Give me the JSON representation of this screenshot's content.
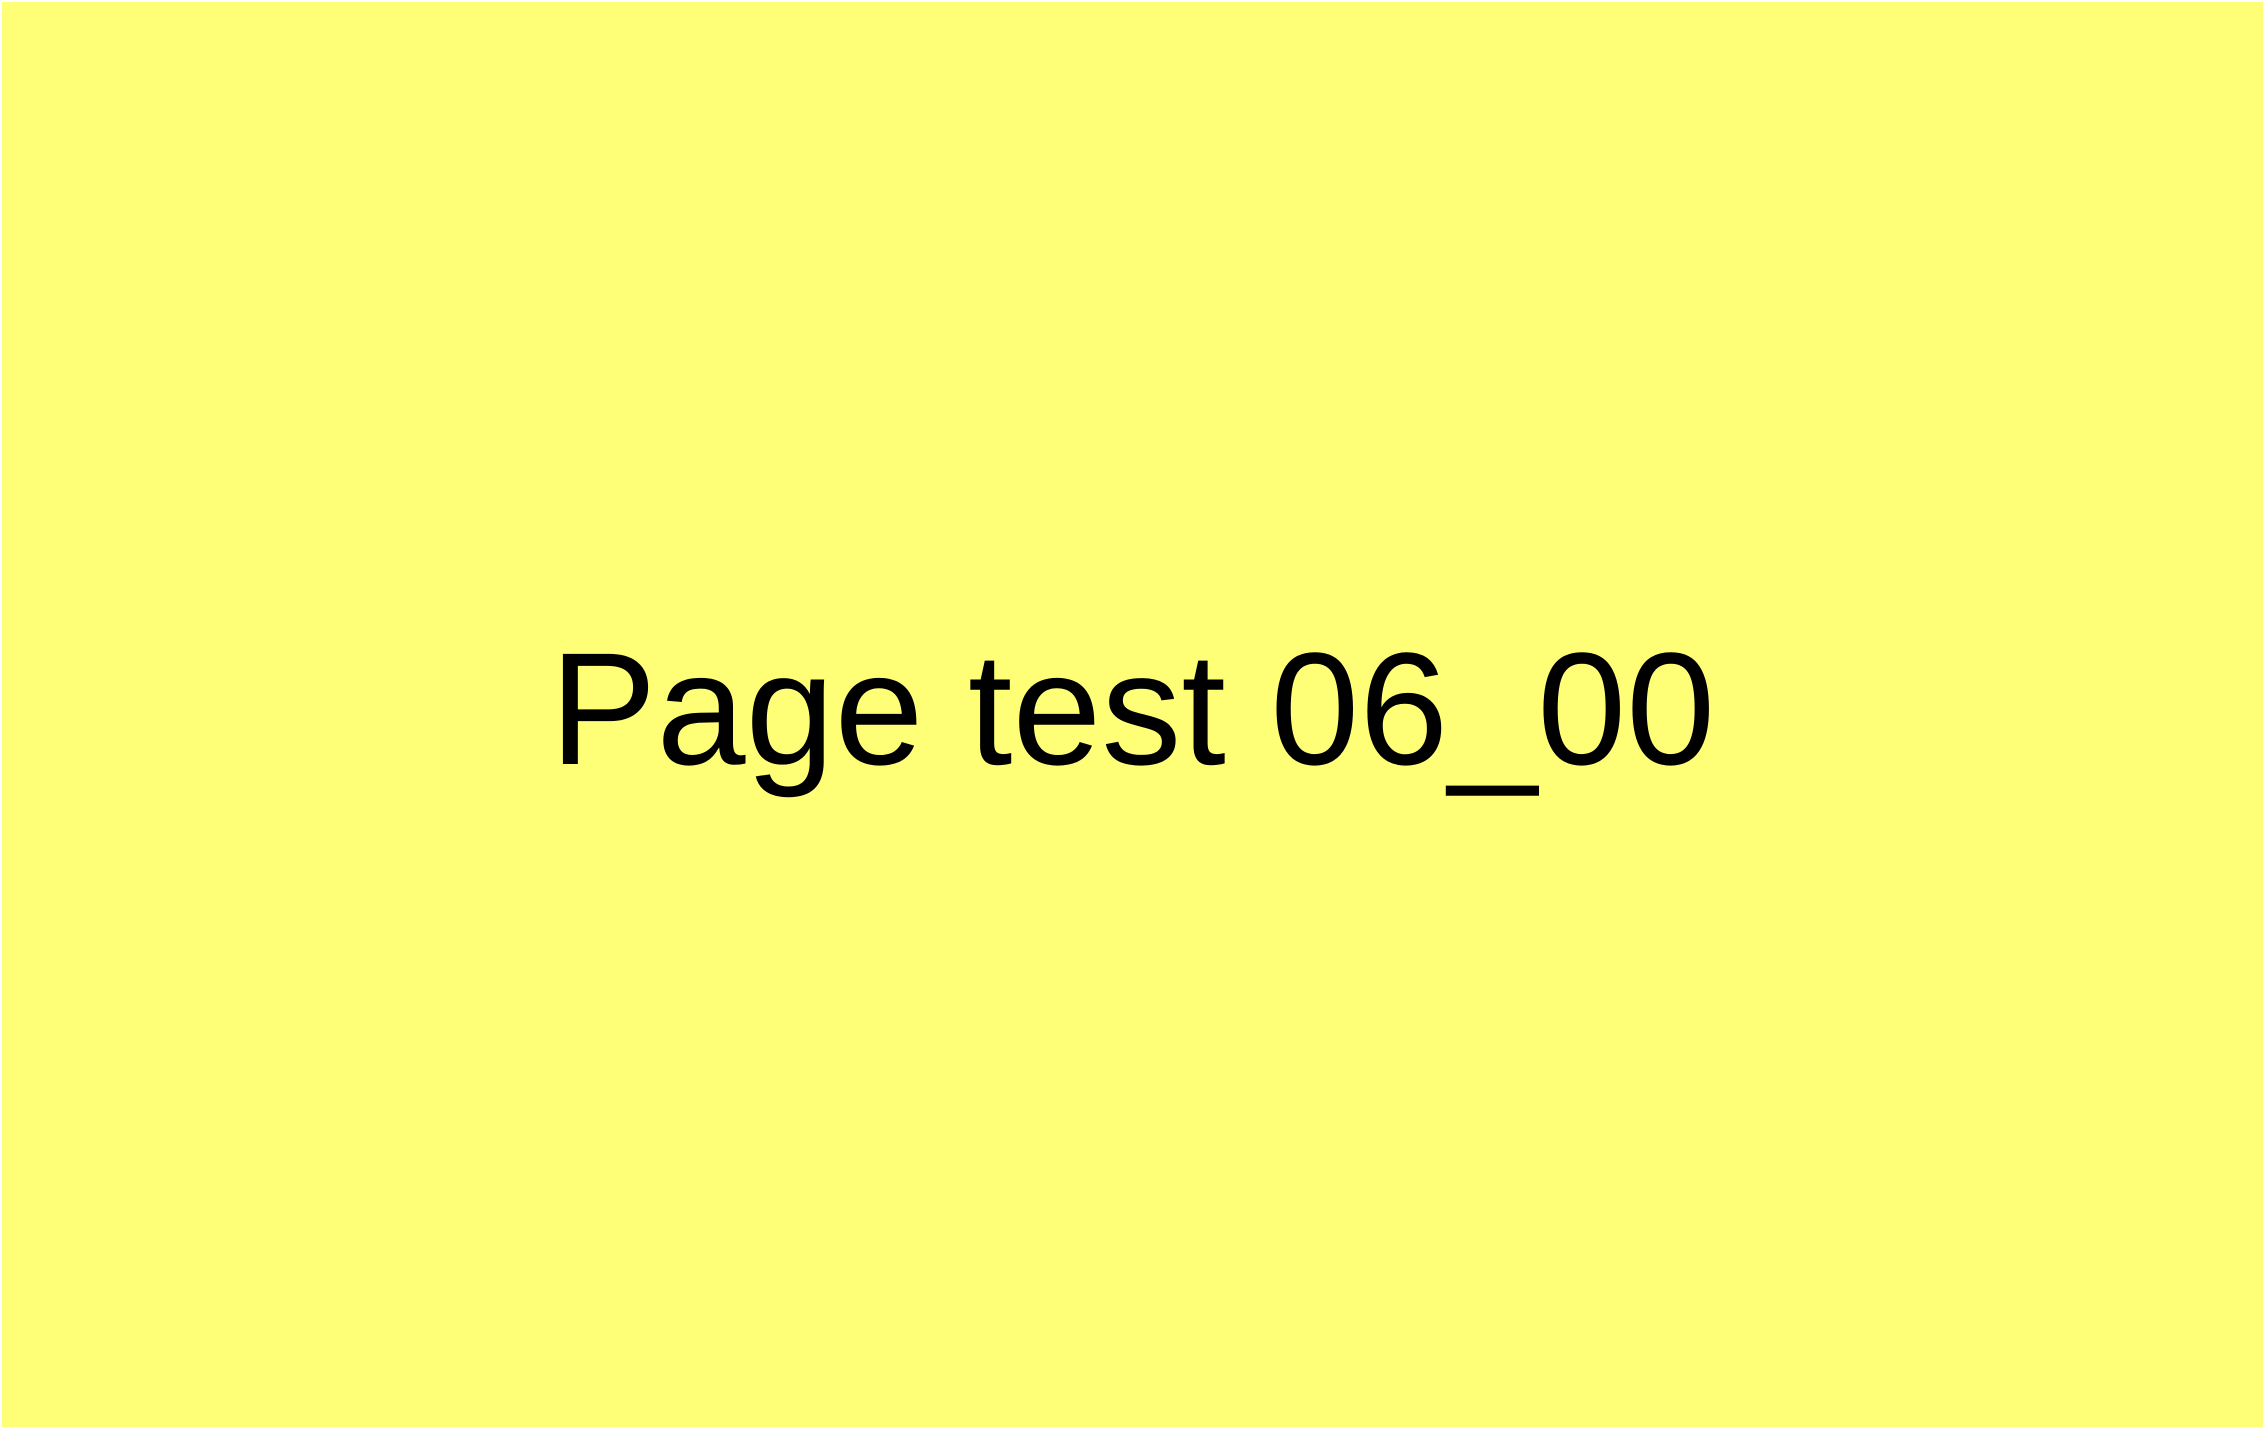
{
  "page": {
    "label": "Page test 06_00",
    "background_color": "#ffff77",
    "text_color": "#000000"
  }
}
